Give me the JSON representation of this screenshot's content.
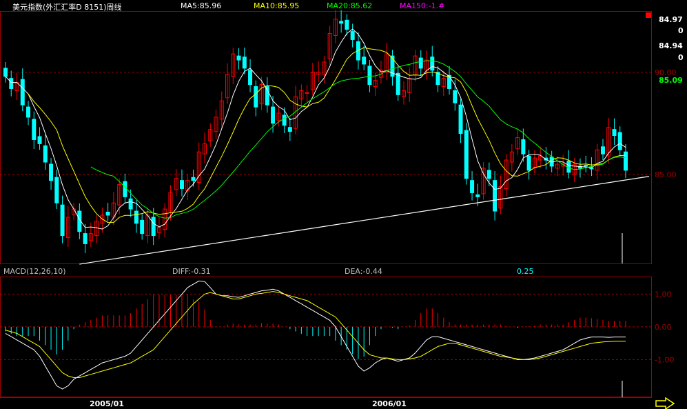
{
  "header": {
    "title": "美元指数(外汇汇率D 8151)周线",
    "ma5": "MA5:85.96",
    "ma10": "MA10:85.95",
    "ma20": "MA20:85.62",
    "ma150": "MA150:-1.#",
    "colors": {
      "title": "#ffffff",
      "ma5": "#ffffff",
      "ma10": "#ffff00",
      "ma20": "#00ff00",
      "ma150": "#ff00ff"
    }
  },
  "right_panel": {
    "price_1": "84.97",
    "vol_1": "0",
    "price_2": "84.94",
    "vol_2": "0",
    "current_price": "85.09",
    "current_color": "#00ff00"
  },
  "macd_header": {
    "label": "MACD(12,26,10)",
    "diff": "DIFF:-0.31",
    "dea": "DEA:-0.44",
    "macd": "0.25",
    "macd_color": "#00ffff"
  },
  "icons": {
    "next": "arrow-right-icon"
  },
  "chart_data": [
    {
      "type": "candlestick",
      "title": "美元指数(外汇汇率D 8151)周线",
      "x_labels": [
        "2005/01",
        "2006/01"
      ],
      "y_ticks": [
        90.0,
        85.0
      ],
      "ylim": [
        80.6,
        93.0
      ],
      "colors": {
        "up": "#ff0000",
        "down": "#00ffff",
        "grid": "#a00000",
        "ma5": "#ffffff",
        "ma10": "#ffff00",
        "ma20": "#00ff00"
      },
      "closes": [
        89.8,
        89.2,
        89.5,
        88.4,
        87.8,
        86.7,
        86.5,
        85.6,
        84.7,
        83.6,
        82.0,
        82.9,
        83.3,
        82.2,
        81.6,
        82.1,
        82.7,
        83.0,
        83.0,
        83.6,
        84.5,
        83.9,
        83.3,
        82.6,
        82.1,
        83.0,
        82.0,
        82.4,
        83.3,
        84.1,
        84.8,
        84.3,
        84.7,
        84.7,
        86.1,
        86.5,
        87.2,
        87.8,
        88.6,
        89.9,
        90.9,
        90.6,
        90.2,
        89.4,
        88.3,
        89.4,
        88.4,
        87.5,
        88.0,
        87.4,
        87.1,
        88.8,
        89.1,
        89.0,
        90.0,
        90.0,
        90.5,
        91.9,
        92.6,
        92.4,
        92.1,
        91.6,
        90.6,
        90.4,
        89.4,
        89.6,
        90.1,
        90.9,
        89.8,
        88.9,
        89.1,
        89.7,
        90.8,
        90.2,
        90.6,
        90.1,
        89.4,
        89.7,
        89.2,
        88.5,
        87.0,
        84.8,
        84.1,
        83.9,
        85.3,
        84.8,
        83.2,
        84.4,
        85.7,
        86.1,
        86.8,
        86.0,
        85.2,
        85.8,
        85.9,
        85.7,
        85.4,
        85.5,
        85.5,
        85.1,
        85.5,
        85.3,
        85.4,
        85.3,
        86.2,
        86.0,
        87.3,
        86.9,
        86.2,
        85.2
      ],
      "series": [
        {
          "name": "MA5",
          "values": []
        },
        {
          "name": "MA10",
          "values": []
        },
        {
          "name": "MA20",
          "values": []
        }
      ],
      "trendlines": [
        {
          "from": [
            "2004/12",
            80.6
          ],
          "to": [
            "2006/11",
            84.9
          ],
          "color": "#ffffff"
        }
      ]
    },
    {
      "type": "bar",
      "title": "MACD(12,26,10)",
      "y_ticks": [
        1.0,
        0.0,
        -1.0
      ],
      "ylim": [
        -2.15,
        1.45
      ],
      "series": [
        {
          "name": "DIFF",
          "values": [
            -0.2,
            -0.3,
            -0.4,
            -0.5,
            -0.6,
            -0.7,
            -0.9,
            -1.2,
            -1.5,
            -1.8,
            -1.9,
            -1.8,
            -1.6,
            -1.5,
            -1.4,
            -1.3,
            -1.2,
            -1.1,
            -1.05,
            -1.0,
            -0.95,
            -0.9,
            -0.8,
            -0.6,
            -0.4,
            -0.2,
            0.0,
            0.2,
            0.4,
            0.6,
            0.8,
            1.0,
            1.2,
            1.3,
            1.4,
            1.38,
            1.2,
            1.0,
            0.95,
            0.95,
            0.92,
            0.9,
            0.95,
            1.0,
            1.05,
            1.1,
            1.12,
            1.15,
            1.1,
            1.0,
            0.9,
            0.8,
            0.7,
            0.6,
            0.5,
            0.4,
            0.3,
            0.2,
            0.0,
            -0.3,
            -0.6,
            -0.9,
            -1.2,
            -1.35,
            -1.25,
            -1.1,
            -1.0,
            -0.95,
            -1.0,
            -1.05,
            -1.0,
            -0.95,
            -0.8,
            -0.6,
            -0.4,
            -0.3,
            -0.3,
            -0.35,
            -0.4,
            -0.45,
            -0.5,
            -0.55,
            -0.6,
            -0.65,
            -0.7,
            -0.75,
            -0.8,
            -0.85,
            -0.9,
            -0.95,
            -1.0,
            -1.0,
            -0.98,
            -0.95,
            -0.9,
            -0.85,
            -0.8,
            -0.75,
            -0.7,
            -0.6,
            -0.5,
            -0.4,
            -0.35,
            -0.31,
            -0.31,
            -0.31,
            -0.32,
            -0.31,
            -0.31,
            -0.31
          ]
        },
        {
          "name": "DEA",
          "values": [
            -0.1,
            -0.15,
            -0.2,
            -0.3,
            -0.4,
            -0.5,
            -0.6,
            -0.8,
            -1.0,
            -1.2,
            -1.4,
            -1.5,
            -1.55,
            -1.55,
            -1.5,
            -1.45,
            -1.4,
            -1.35,
            -1.3,
            -1.25,
            -1.2,
            -1.15,
            -1.1,
            -1.0,
            -0.9,
            -0.8,
            -0.7,
            -0.5,
            -0.3,
            -0.1,
            0.1,
            0.3,
            0.5,
            0.7,
            0.85,
            1.0,
            1.05,
            1.0,
            0.95,
            0.9,
            0.85,
            0.85,
            0.9,
            0.95,
            1.0,
            1.02,
            1.05,
            1.08,
            1.05,
            1.0,
            0.95,
            0.9,
            0.85,
            0.8,
            0.7,
            0.6,
            0.5,
            0.4,
            0.3,
            0.1,
            -0.1,
            -0.3,
            -0.5,
            -0.7,
            -0.85,
            -0.9,
            -0.95,
            -0.95,
            -0.98,
            -1.0,
            -1.0,
            -0.98,
            -0.95,
            -0.9,
            -0.8,
            -0.7,
            -0.6,
            -0.55,
            -0.5,
            -0.5,
            -0.55,
            -0.6,
            -0.65,
            -0.7,
            -0.75,
            -0.8,
            -0.85,
            -0.9,
            -0.92,
            -0.95,
            -0.98,
            -1.0,
            -1.0,
            -0.98,
            -0.95,
            -0.9,
            -0.85,
            -0.8,
            -0.75,
            -0.7,
            -0.65,
            -0.6,
            -0.55,
            -0.5,
            -0.48,
            -0.46,
            -0.45,
            -0.44,
            -0.44,
            -0.44
          ]
        },
        {
          "name": "MACD",
          "values": []
        }
      ],
      "colors": {
        "diff": "#ffffff",
        "dea": "#ffff00",
        "pos": "#ff0000",
        "neg": "#00ffff",
        "grid": "#a00000"
      }
    }
  ]
}
